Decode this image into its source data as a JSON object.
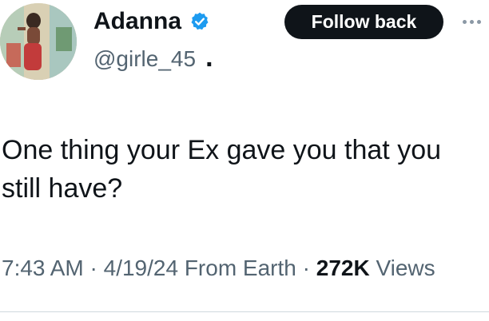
{
  "author": {
    "display_name": "Adanna",
    "handle": "@girle_45",
    "separator_dot": ".",
    "verified_icon": "verified-badge-icon",
    "verified_color": "#1d9bf0"
  },
  "actions": {
    "follow_label": "Follow back",
    "more_icon": "more-horizontal-icon"
  },
  "tweet": {
    "text": "One thing your Ex gave you that you still have?"
  },
  "meta": {
    "time": "7:43 AM",
    "sep1": " · ",
    "date": "4/19/24",
    "source": " From Earth",
    "sep2": " · ",
    "views_count": "272K",
    "views_label": " Views"
  }
}
